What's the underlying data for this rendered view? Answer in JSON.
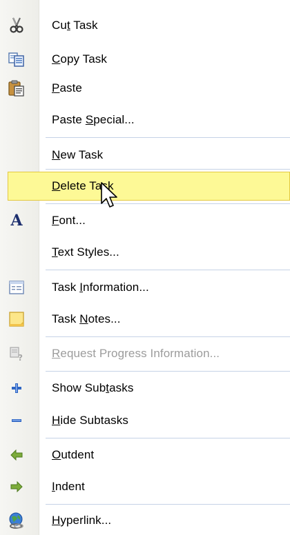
{
  "menu": {
    "items": [
      {
        "name": "cut-task",
        "pre": "Cu",
        "key": "t",
        "post": " Task",
        "icon": "scissors-icon",
        "disabled": false
      },
      {
        "name": "copy-task",
        "pre": "",
        "key": "C",
        "post": "opy Task",
        "icon": "copy-icon",
        "disabled": false
      },
      {
        "name": "paste",
        "pre": "",
        "key": "P",
        "post": "aste",
        "icon": "paste-icon",
        "disabled": false
      },
      {
        "name": "paste-special",
        "pre": "Paste ",
        "key": "S",
        "post": "pecial...",
        "icon": "",
        "disabled": false
      },
      {
        "name": "new-task",
        "pre": "",
        "key": "N",
        "post": "ew Task",
        "icon": "",
        "disabled": false
      },
      {
        "name": "delete-task",
        "pre": "",
        "key": "D",
        "post": "elete Task",
        "icon": "",
        "disabled": false
      },
      {
        "name": "font",
        "pre": "",
        "key": "F",
        "post": "ont...",
        "icon": "font-icon",
        "disabled": false
      },
      {
        "name": "text-styles",
        "pre": "",
        "key": "T",
        "post": "ext Styles...",
        "icon": "",
        "disabled": false
      },
      {
        "name": "task-information",
        "pre": "Task ",
        "key": "I",
        "post": "nformation...",
        "icon": "task-information-icon",
        "disabled": false
      },
      {
        "name": "task-notes",
        "pre": "Task ",
        "key": "N",
        "post": "otes...",
        "icon": "task-notes-icon",
        "disabled": false
      },
      {
        "name": "request-progress-information",
        "pre": "",
        "key": "R",
        "post": "equest Progress Information...",
        "icon": "request-progress-icon",
        "disabled": true
      },
      {
        "name": "show-subtasks",
        "pre": "Show Sub",
        "key": "t",
        "post": "asks",
        "icon": "plus-icon",
        "disabled": false
      },
      {
        "name": "hide-subtasks",
        "pre": "",
        "key": "H",
        "post": "ide Subtasks",
        "icon": "minus-icon",
        "disabled": false
      },
      {
        "name": "outdent",
        "pre": "",
        "key": "O",
        "post": "utdent",
        "icon": "arrow-left-icon",
        "disabled": false
      },
      {
        "name": "indent",
        "pre": "",
        "key": "I",
        "post": "ndent",
        "icon": "arrow-right-icon",
        "disabled": false
      },
      {
        "name": "hyperlink",
        "pre": "",
        "key": "H",
        "post": "yperlink...",
        "icon": "hyperlink-icon",
        "disabled": false
      }
    ],
    "highlighted_item": "delete-task",
    "colors": {
      "highlight_fill": "#fdf996",
      "highlight_border": "#e3c83f",
      "separator": "#c5d2e6",
      "disabled_text": "#9c9c9c"
    }
  }
}
